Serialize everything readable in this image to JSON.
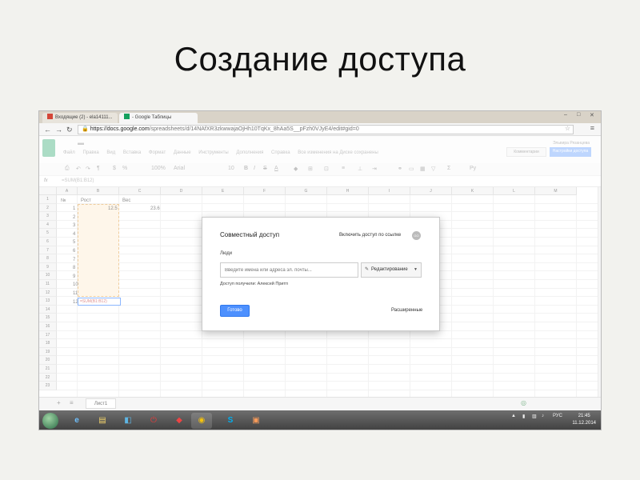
{
  "slide": {
    "title": "Создание доступа"
  },
  "browser": {
    "tabs": [
      {
        "label": "Входящие (2) - ela14111...",
        "icon": "gmail-icon"
      },
      {
        "label": "- Google Таблицы",
        "icon": "sheets-icon"
      }
    ],
    "url_host": "https://docs.google.com",
    "url_path": "/spreadsheets/d/14NAfXR3zkwwajaOjHh10TqKx_8hAa5S__pFzh0VJyE4/edit#gid=0"
  },
  "docs": {
    "menu": [
      "Файл",
      "Правка",
      "Вид",
      "Вставка",
      "Формат",
      "Данные",
      "Инструменты",
      "Дополнения",
      "Справка",
      "Все изменения на Диске сохранены"
    ],
    "comments_label": "Комментарии",
    "share_label": "Настройки доступа",
    "account": "Эльвира Рязанцева",
    "zoom": "100%",
    "font": "Arial",
    "font_size": "10"
  },
  "formula_bar": {
    "label": "fx",
    "value": "=SUM(B1:B12)"
  },
  "grid": {
    "columns": [
      "A",
      "B",
      "C",
      "D",
      "E",
      "F",
      "G",
      "H",
      "I",
      "J",
      "K",
      "L",
      "M"
    ],
    "rows": [
      "1",
      "2",
      "3",
      "4",
      "5",
      "6",
      "7",
      "8",
      "9",
      "10",
      "11",
      "12",
      "13",
      "14",
      "15",
      "16",
      "17",
      "18",
      "19",
      "20",
      "21",
      "22",
      "23"
    ],
    "header_a": "№",
    "header_b": "Рост",
    "header_c": "Вес",
    "b2": "12.5",
    "c2": "23.6",
    "a_values": [
      "1",
      "2",
      "3",
      "4",
      "5",
      "6",
      "7",
      "8",
      "9",
      "10",
      "11",
      "12"
    ],
    "formula_cell": "=SUM(B1:B12)"
  },
  "sheet_tab": "Лист1",
  "dialog": {
    "title": "Совместный доступ",
    "link_sharing": "Включить доступ по ссылке",
    "people_label": "Люди",
    "input_placeholder": "Введите имена или адреса эл. почты...",
    "permission": "Редактирование",
    "access_text": "Доступ получили: Алексей Притп",
    "done_label": "Готово",
    "advanced_label": "Расширенные"
  },
  "taskbar": {
    "lang": "РУС",
    "time": "21:45",
    "date": "11.12.2014"
  },
  "colors": {
    "accent": "#4d90fe",
    "sheets_green": "#16a05e"
  }
}
